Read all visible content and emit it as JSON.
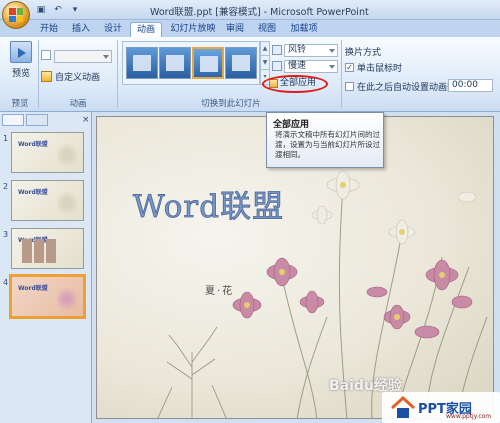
{
  "window": {
    "title": "Word联盟.ppt [兼容模式] - Microsoft PowerPoint"
  },
  "tabs": [
    "开始",
    "插入",
    "设计",
    "动画",
    "幻灯片放映",
    "审阅",
    "视图",
    "加载项"
  ],
  "active_tab": "动画",
  "ribbon": {
    "preview_group": {
      "button": "预览",
      "label": "预览"
    },
    "animation_group": {
      "custom_animation": "自定义动画",
      "label": "动画"
    },
    "transition_group": {
      "label": "切换到此幻灯片",
      "sound": "风铃",
      "speed": "慢速",
      "apply_all": "全部应用"
    },
    "advance_group": {
      "title": "换片方式",
      "on_click": "单击鼠标时",
      "on_click_checked": "✓",
      "auto_after": "在此之后自动设置动画效果:",
      "time": "00:00"
    }
  },
  "tooltip": {
    "title": "全部应用",
    "body": "将演示文稿中所有幻灯片间的过渡，设置为与当前幻灯片所设过渡相同。"
  },
  "slides_panel": {
    "tab_slides": "",
    "close": "×",
    "thumbnails": [
      {
        "num": "1",
        "title": "Word联盟"
      },
      {
        "num": "2",
        "title": "Word联盟"
      },
      {
        "num": "3",
        "title": "Word联盟"
      },
      {
        "num": "4",
        "title": "Word联盟",
        "selected": true
      }
    ]
  },
  "slide": {
    "title": "Word联盟",
    "subtitle": "夏·花",
    "watermark": "Baidu经验"
  },
  "brand": {
    "text": "PPT家园",
    "url": "www.pptjy.com"
  },
  "colors": {
    "ribbon_bg": "#dce9f8",
    "tab_text": "#15428b",
    "highlight_ring": "#e21a1a",
    "selected_thumb": "#f0a030",
    "slide_title": "#7a96c2"
  }
}
